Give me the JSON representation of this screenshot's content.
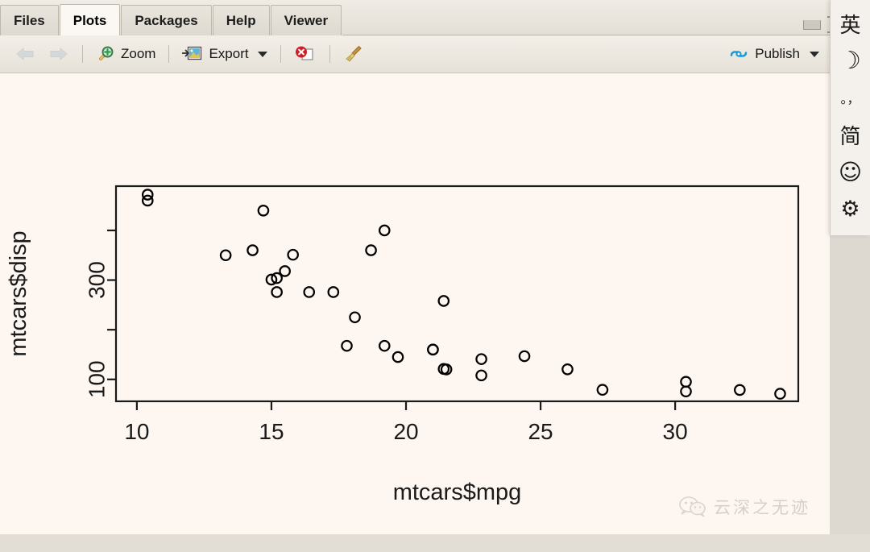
{
  "window": {
    "minimize_icon": "minimize-pane-icon",
    "maximize_icon": "maximize-pane-icon"
  },
  "tabs": [
    {
      "label": "Files",
      "active": false
    },
    {
      "label": "Plots",
      "active": true
    },
    {
      "label": "Packages",
      "active": false
    },
    {
      "label": "Help",
      "active": false
    },
    {
      "label": "Viewer",
      "active": false
    }
  ],
  "toolbar": {
    "back_icon": "back-arrow-icon",
    "forward_icon": "forward-arrow-icon",
    "zoom_label": "Zoom",
    "zoom_icon": "magnifier-plus-icon",
    "export_label": "Export",
    "export_icon": "export-image-icon",
    "export_caret_icon": "chevron-down-icon",
    "remove_icon": "remove-plot-icon",
    "clear_icon": "broom-clear-all-icon",
    "publish_label": "Publish",
    "publish_icon": "publish-icon",
    "publish_caret_icon": "chevron-down-icon"
  },
  "ime": {
    "items": [
      {
        "glyph": "英",
        "name": "ime-language-english"
      },
      {
        "glyph": "☽",
        "name": "ime-night-mode"
      },
      {
        "glyph": "。，",
        "name": "ime-punctuation-mode"
      },
      {
        "glyph": "简",
        "name": "ime-simplified-chinese"
      },
      {
        "glyph": "☺",
        "name": "ime-emoji"
      },
      {
        "glyph": "⚙",
        "name": "ime-settings"
      }
    ]
  },
  "watermark": {
    "text": "云深之无迹",
    "icon": "wechat-icon"
  },
  "chart_data": {
    "type": "scatter",
    "title": "",
    "xlabel": "mtcars$mpg",
    "ylabel": "mtcars$disp",
    "xlim": [
      9.225,
      34.575
    ],
    "ylim": [
      55.85,
      489.15
    ],
    "xticks": [
      10,
      15,
      20,
      25,
      30
    ],
    "yticks": [
      100,
      200,
      300,
      400
    ],
    "ytick_labels": [
      "100",
      "",
      "300",
      ""
    ],
    "grid": false,
    "legend": null,
    "point_symbol": "open-circle",
    "point_color": "#000000",
    "background": "#fdf6f1",
    "x": [
      21.0,
      21.0,
      22.8,
      21.4,
      18.7,
      18.1,
      14.3,
      24.4,
      22.8,
      19.2,
      17.8,
      16.4,
      17.3,
      15.2,
      10.4,
      10.4,
      14.7,
      32.4,
      30.4,
      33.9,
      21.5,
      15.5,
      15.2,
      13.3,
      19.2,
      27.3,
      26.0,
      30.4,
      15.8,
      19.7,
      15.0,
      21.4
    ],
    "y": [
      160.0,
      160.0,
      108.0,
      258.0,
      360.0,
      225.0,
      360.0,
      146.7,
      140.8,
      167.6,
      167.6,
      275.8,
      275.8,
      275.8,
      472.0,
      460.0,
      440.0,
      78.7,
      75.7,
      71.1,
      120.1,
      318.0,
      304.0,
      350.0,
      400.0,
      79.0,
      120.3,
      95.1,
      351.0,
      145.0,
      301.0,
      121.0
    ]
  }
}
